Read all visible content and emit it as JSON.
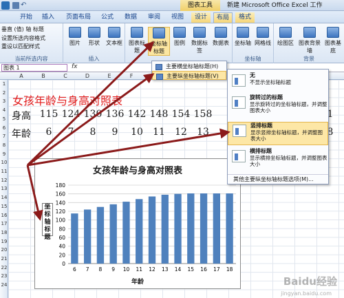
{
  "window": {
    "chart_tools_label": "图表工具",
    "app_title": "新建 Microsoft Office Excel 工作"
  },
  "tabs": [
    "开始",
    "插入",
    "页面布局",
    "公式",
    "数据",
    "审阅",
    "视图",
    "设计",
    "布局",
    "格式"
  ],
  "active_tab": "布局",
  "ribbon": {
    "selection_box": "垂直 (值) 轴 标题",
    "format_selection": "设置所选内容格式",
    "reset_style": "重设以匹配样式",
    "current_selection_group": "当前所选内容",
    "insert_group": "插入",
    "insert_buttons": [
      "图片",
      "形状",
      "文本框"
    ],
    "label_buttons": [
      "图表标题",
      "坐标轴标题",
      "图例",
      "数据标签",
      "数据表"
    ],
    "axes_buttons": [
      "坐标轴",
      "网格线"
    ],
    "axes_group": "坐标轴",
    "background_buttons": [
      "绘图区",
      "图表背景墙",
      "图表基底"
    ],
    "background_group": "背景"
  },
  "formula_bar": {
    "name_box": "图表 1",
    "fx": "fx"
  },
  "columns": [
    "A",
    "B",
    "C",
    "D",
    "E",
    "F",
    "G",
    "H",
    "I"
  ],
  "rows": [
    "1",
    "2",
    "3",
    "4",
    "5",
    "6",
    "7",
    "8",
    "9",
    "10",
    "11",
    "12",
    "13",
    "14",
    "15",
    "16",
    "17",
    "18",
    "19",
    "20",
    "21",
    "22",
    "23",
    "24"
  ],
  "sheet": {
    "title": "女孩年龄与身高对照表",
    "height_label": "身高",
    "heights": [
      "115",
      "124",
      "130",
      "136",
      "142",
      "148",
      "154",
      "158"
    ],
    "height_extra": "1",
    "age_label": "年龄",
    "ages": [
      "6",
      "7",
      "8",
      "9",
      "10",
      "11",
      "12",
      "13"
    ],
    "age_extra": "8"
  },
  "axis_title_menu": {
    "items": [
      "主要横坐标轴标题(H)",
      "主要纵坐标轴标题(V)"
    ],
    "selected_index": 1
  },
  "vertical_title_submenu": {
    "items": [
      {
        "title": "无",
        "desc": "不显示坐标轴标题"
      },
      {
        "title": "旋转过的标题",
        "desc": "显示旋转过的坐标轴标题，并调整图表大小"
      },
      {
        "title": "竖排标题",
        "desc": "显示竖排坐标轴标题，并调整图表大小"
      },
      {
        "title": "横排标题",
        "desc": "显示横排坐标轴标题，并调整图表大小"
      }
    ],
    "highlighted_index": 2,
    "footer": "其他主要纵坐标轴标题选项(M)..."
  },
  "chart_data": {
    "type": "bar",
    "title": "女孩年龄与身高对照表",
    "xlabel": "年龄",
    "ylabel": "坐标轴标题",
    "categories": [
      "6",
      "7",
      "8",
      "9",
      "10",
      "11",
      "12",
      "13",
      "14",
      "15",
      "16",
      "17",
      "18"
    ],
    "values": [
      115,
      124,
      130,
      136,
      142,
      148,
      154,
      158,
      160,
      161,
      161,
      161,
      161
    ],
    "ylim": [
      0,
      180
    ],
    "yticks": [
      "0",
      "20",
      "40",
      "60",
      "80",
      "100",
      "120",
      "140",
      "160",
      "180"
    ],
    "grid": true,
    "bar_color": "#4f81bd",
    "grid_color": "#d0d0d0"
  },
  "watermark": {
    "text": "Baidu经验",
    "sub": "jingyan.baidu.com"
  },
  "colors": {
    "arrow": "#8b1a1a",
    "title_red": "#e21b1b"
  }
}
